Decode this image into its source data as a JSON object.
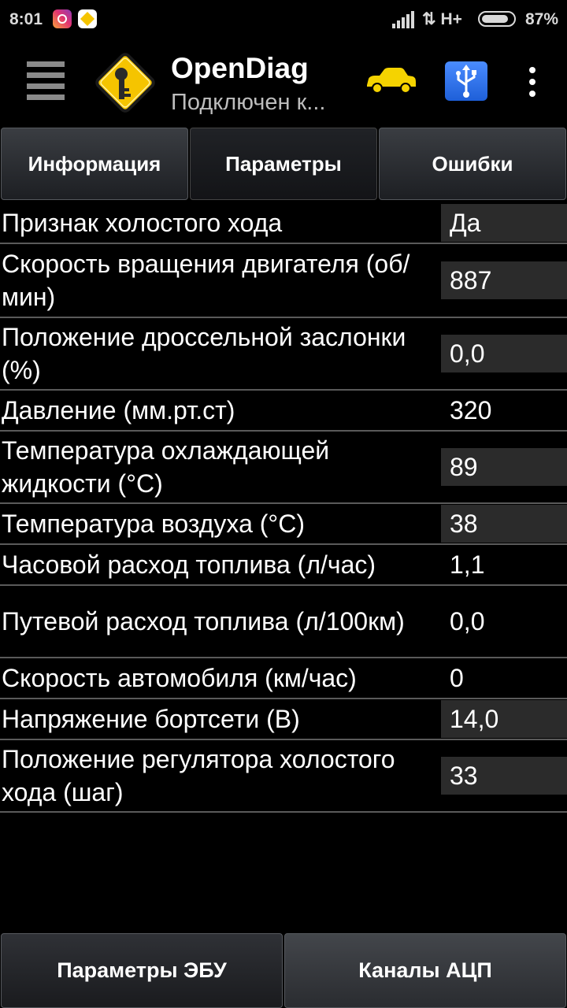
{
  "status_bar": {
    "time": "8:01",
    "network": "H+",
    "battery_percent": "87%",
    "battery_level": 0.87,
    "notification_icons": [
      "instagram-icon",
      "app-notification-icon"
    ]
  },
  "app_bar": {
    "title": "OpenDiag",
    "subtitle": "Подключен к...",
    "icons": [
      "menu-icon",
      "app-logo-icon",
      "car-icon",
      "usb-icon",
      "overflow-menu-icon"
    ]
  },
  "tabs": [
    {
      "label": "Информация",
      "active": false
    },
    {
      "label": "Параметры",
      "active": true
    },
    {
      "label": "Ошибки",
      "active": false
    }
  ],
  "parameters": [
    {
      "label": "Признак холостого хода",
      "value": "Да"
    },
    {
      "label": "Скорость вращения двигателя (об/мин)",
      "value": "887"
    },
    {
      "label": "Положение дроссельной заслонки (%)",
      "value": "0,0"
    },
    {
      "label": "Давление (мм.рт.ст)",
      "value": "320"
    },
    {
      "label": "Температура охлаждающей жидкости (°C)",
      "value": "89"
    },
    {
      "label": "Температура воздуха (°C)",
      "value": "38"
    },
    {
      "label": "Часовой расход топлива (л/час)",
      "value": "1,1"
    },
    {
      "label": "Путевой расход топлива (л/100км)",
      "value": "0,0"
    },
    {
      "label": "Скорость автомобиля (км/час)",
      "value": "0"
    },
    {
      "label": "Напряжение бортсети (В)",
      "value": "14,0"
    },
    {
      "label": "Положение регулятора холостого хода (шаг)",
      "value": "33"
    }
  ],
  "bottom_buttons": [
    {
      "label": "Параметры ЭБУ"
    },
    {
      "label": "Каналы АЦП"
    }
  ],
  "colors": {
    "background": "#000000",
    "value_shade": "#2b2b2b",
    "car_icon": "#f5d300",
    "usb_icon": "#2f6fe8"
  }
}
